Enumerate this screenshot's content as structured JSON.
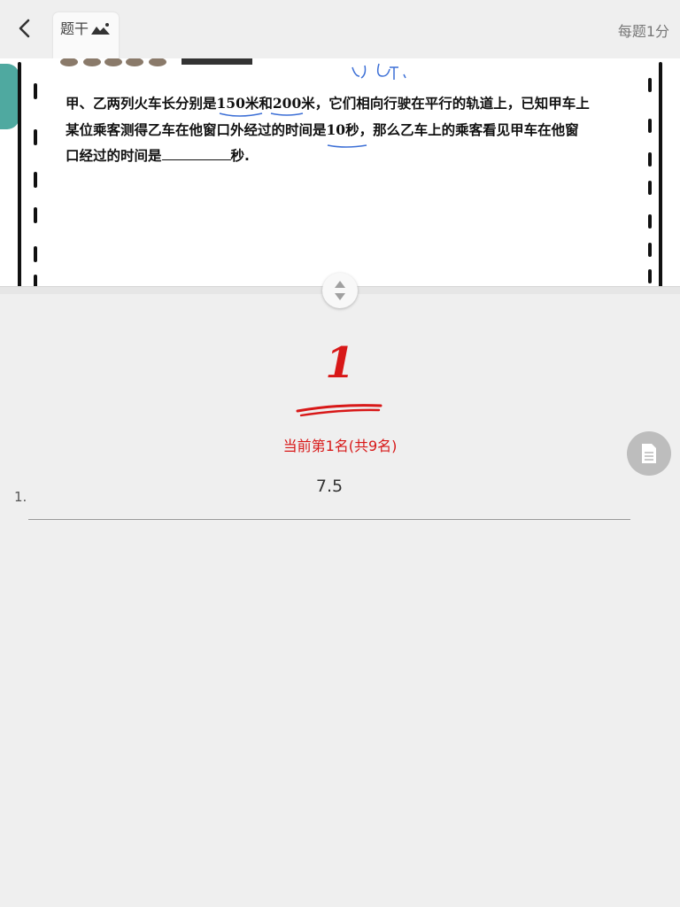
{
  "header": {
    "back_icon": "chevron-left-icon",
    "tab_label": "题干",
    "tab_icon": "image-icon",
    "score_label": "每题1分"
  },
  "question": {
    "line1_pre": "甲、乙两列火车长分别是",
    "len_a": "150",
    "unit_a": "米和",
    "len_b": "200",
    "line1_post": "米，它们相向行驶在平行的轨道上，已知甲车上",
    "line2_pre": "某位乘客测得乙车在他窗口外经过的时间是",
    "time": "10",
    "line2_post": "秒，那么乙车上的乘客看见甲车在他窗",
    "line3_pre": "口经过的时间是",
    "line3_post": "秒."
  },
  "result": {
    "rank_number": "1",
    "rank_text": "当前第1名(共9名)",
    "accent_color": "#d81818"
  },
  "answer": {
    "index": "1.",
    "value": "7.5"
  },
  "side_button_icon": "document-icon"
}
